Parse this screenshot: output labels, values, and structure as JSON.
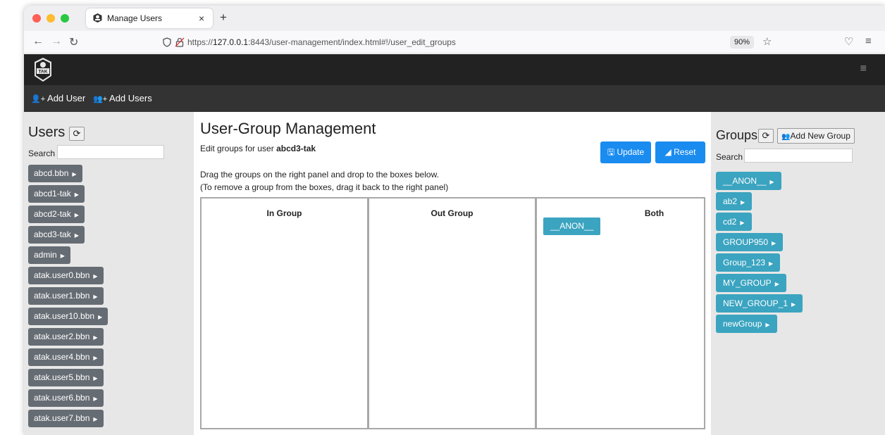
{
  "browser": {
    "tab_title": "Manage Users",
    "tab_close": "×",
    "new_tab": "+",
    "url_prefix": "https://",
    "url_host": "127.0.0.1",
    "url_rest": ":8443/user-management/index.html#!/user_edit_groups",
    "zoom": "90%"
  },
  "app": {
    "logo_text": "TAK",
    "toolbar": {
      "add_user": "Add User",
      "add_users": "Add Users"
    }
  },
  "users_panel": {
    "title": "Users",
    "search_label": "Search",
    "search_value": "",
    "users": [
      "abcd.bbn",
      "abcd1-tak",
      "abcd2-tak",
      "abcd3-tak",
      "admin",
      "atak.user0.bbn",
      "atak.user1.bbn",
      "atak.user10.bbn",
      "atak.user2.bbn",
      "atak.user4.bbn",
      "atak.user5.bbn",
      "atak.user6.bbn",
      "atak.user7.bbn"
    ]
  },
  "main": {
    "title": "User-Group Management",
    "edit_prefix": "Edit groups for user ",
    "edit_user": "abcd3-tak",
    "update_label": "Update",
    "reset_label": "Reset",
    "instruction1": "Drag the groups on the right panel and drop to the boxes below.",
    "instruction2": "(To remove a group from the boxes, drag it back to the right panel)",
    "boxes": {
      "in_group": {
        "title": "In Group",
        "items": []
      },
      "out_group": {
        "title": "Out Group",
        "items": []
      },
      "both": {
        "title": "Both",
        "items": [
          "__ANON__"
        ]
      }
    }
  },
  "groups_panel": {
    "title": "Groups",
    "add_label": "Add New Group",
    "search_label": "Search",
    "search_value": "",
    "groups": [
      "__ANON__",
      "ab2",
      "cd2",
      "GROUP950",
      "Group_123",
      "MY_GROUP",
      "NEW_GROUP_1",
      "newGroup"
    ]
  },
  "colors": {
    "primary_button": "#1a8cf0",
    "group_chip": "#3ba4c0",
    "user_button": "#666c73",
    "header_dark": "#222222"
  }
}
